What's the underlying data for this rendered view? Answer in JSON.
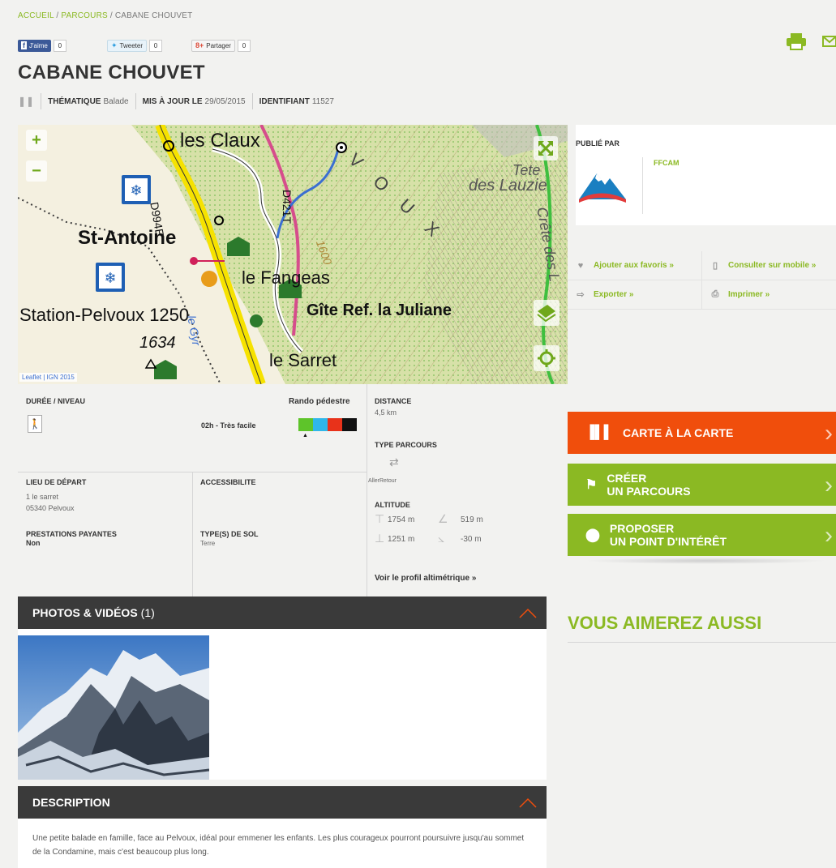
{
  "breadcrumb": {
    "home": "ACCUEIL",
    "sep1": "/",
    "section": "PARCOURS",
    "sep2": "/",
    "current": "CABANE CHOUVET"
  },
  "social": [
    {
      "label": "J'aime",
      "count": "0",
      "color": "#3b5998"
    },
    {
      "label": "Tweeter",
      "count": "0",
      "color": "#2b9de0"
    },
    {
      "label": "Partager",
      "count": "0",
      "color": "#dd4b39"
    }
  ],
  "page": {
    "title": "CABANE CHOUVET"
  },
  "meta": {
    "thematique_label": "THÉMATIQUE",
    "thematique_value": "Balade",
    "maj_label": "MIS À JOUR LE",
    "maj_value": "29/05/2015",
    "id_label": "IDENTIFIANT",
    "id_value": "11527"
  },
  "map": {
    "labels": {
      "claux": "les Claux",
      "st_antoine": "St-Antoine",
      "fangeas": "le Fangeas",
      "station": "Station-Pelvoux 1250",
      "gite": "Gîte Ref. la Juliane",
      "sarret": "le Sarret",
      "alt": "1634",
      "d994": "D994E",
      "d421": "D421T",
      "c1600": "1600",
      "lauzie1": "Tete",
      "lauzie2": "des Lauzie",
      "crete": "Crête des L",
      "vivoux": "V O U X",
      "gyr": "le Gyr"
    },
    "attribution": "Leaflet | IGN 2015",
    "zoom_in": "+",
    "zoom_out": "−"
  },
  "publisher": {
    "heading": "PUBLIÉ PAR",
    "name": "FFCAM"
  },
  "actions": {
    "favoris": "Ajouter aux favoris »",
    "mobile": "Consulter sur mobile »",
    "exporter": "Exporter »",
    "imprimer": "Imprimer »"
  },
  "cta": {
    "carte": "CARTE À LA CARTE",
    "creer1": "CRÉER",
    "creer2": "UN PARCOURS",
    "proposer1": "PROPOSER",
    "proposer2": "UN POINT D'INTÉRÊT"
  },
  "colors": {
    "orange": "#f04e0c",
    "green": "#8bb923",
    "dark": "#3a3a3a"
  },
  "aimez": "VOUS AIMEREZ AUSSI",
  "info": {
    "duree_label": "DURÉE / NIVEAU",
    "activity": "Rando pédestre",
    "duration": "02h - Très facile",
    "distance_label": "DISTANCE",
    "distance_value": "4,5 km",
    "type_label": "TYPE PARCOURS",
    "type_value": "AllerRetour",
    "altitude_label": "ALTITUDE",
    "alt_max": "1754 m",
    "alt_gain": "519 m",
    "alt_min": "1251 m",
    "alt_loss": "-30 m",
    "profil": "Voir le profil altimétrique »",
    "depart_label": "LIEU DE DÉPART",
    "depart_line1": "1 le sarret",
    "depart_line2": "05340 Pelvoux",
    "access_label": "ACCESSIBILITE",
    "prest_label": "PRESTATIONS PAYANTES",
    "prest_value": "Non",
    "sol_label": "TYPE(S) DE SOL",
    "sol_value": "Terre"
  },
  "photos": {
    "title": "PHOTOS & VIDÉOS",
    "count": "(1)"
  },
  "description": {
    "title": "DESCRIPTION",
    "text": "Une petite balade en famille, face au Pelvoux, idéal pour emmener les enfants. Les plus courageux pourront poursuivre jusqu'au sommet de la Condamine, mais c'est beaucoup plus long."
  }
}
